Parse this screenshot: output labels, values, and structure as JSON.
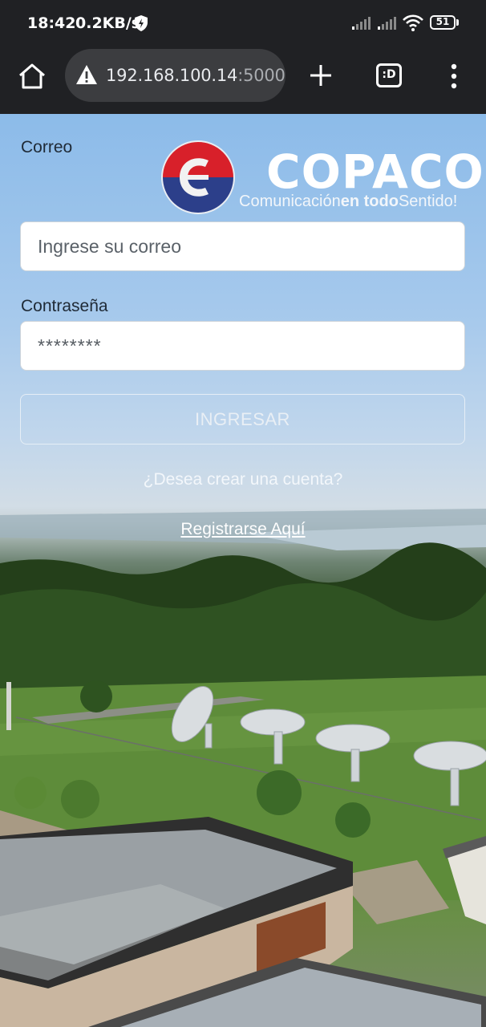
{
  "status_bar": {
    "time": "18:42",
    "speed": "0.2KB/s",
    "battery": "51"
  },
  "browser": {
    "url_host": "192.168.100.14",
    "url_port": ":5000",
    "tabs_label": ":D"
  },
  "brand": {
    "name": "COPACO",
    "tagline_part1": "Comunicación",
    "tagline_part2": "en todo",
    "tagline_part3": "Sentido!"
  },
  "form": {
    "email_label": "Correo",
    "email_placeholder": "Ingrese su correo",
    "password_label": "Contraseña",
    "password_value": "********",
    "submit_label": "INGRESAR",
    "signup_prompt": "¿Desea crear una cuenta?",
    "signup_link": "Registrarse Aquí"
  },
  "colors": {
    "browser_bg": "#202124",
    "urlbar_bg": "#3c3d40",
    "brand_red": "#d8202a",
    "brand_blue": "#2c3f8a"
  }
}
